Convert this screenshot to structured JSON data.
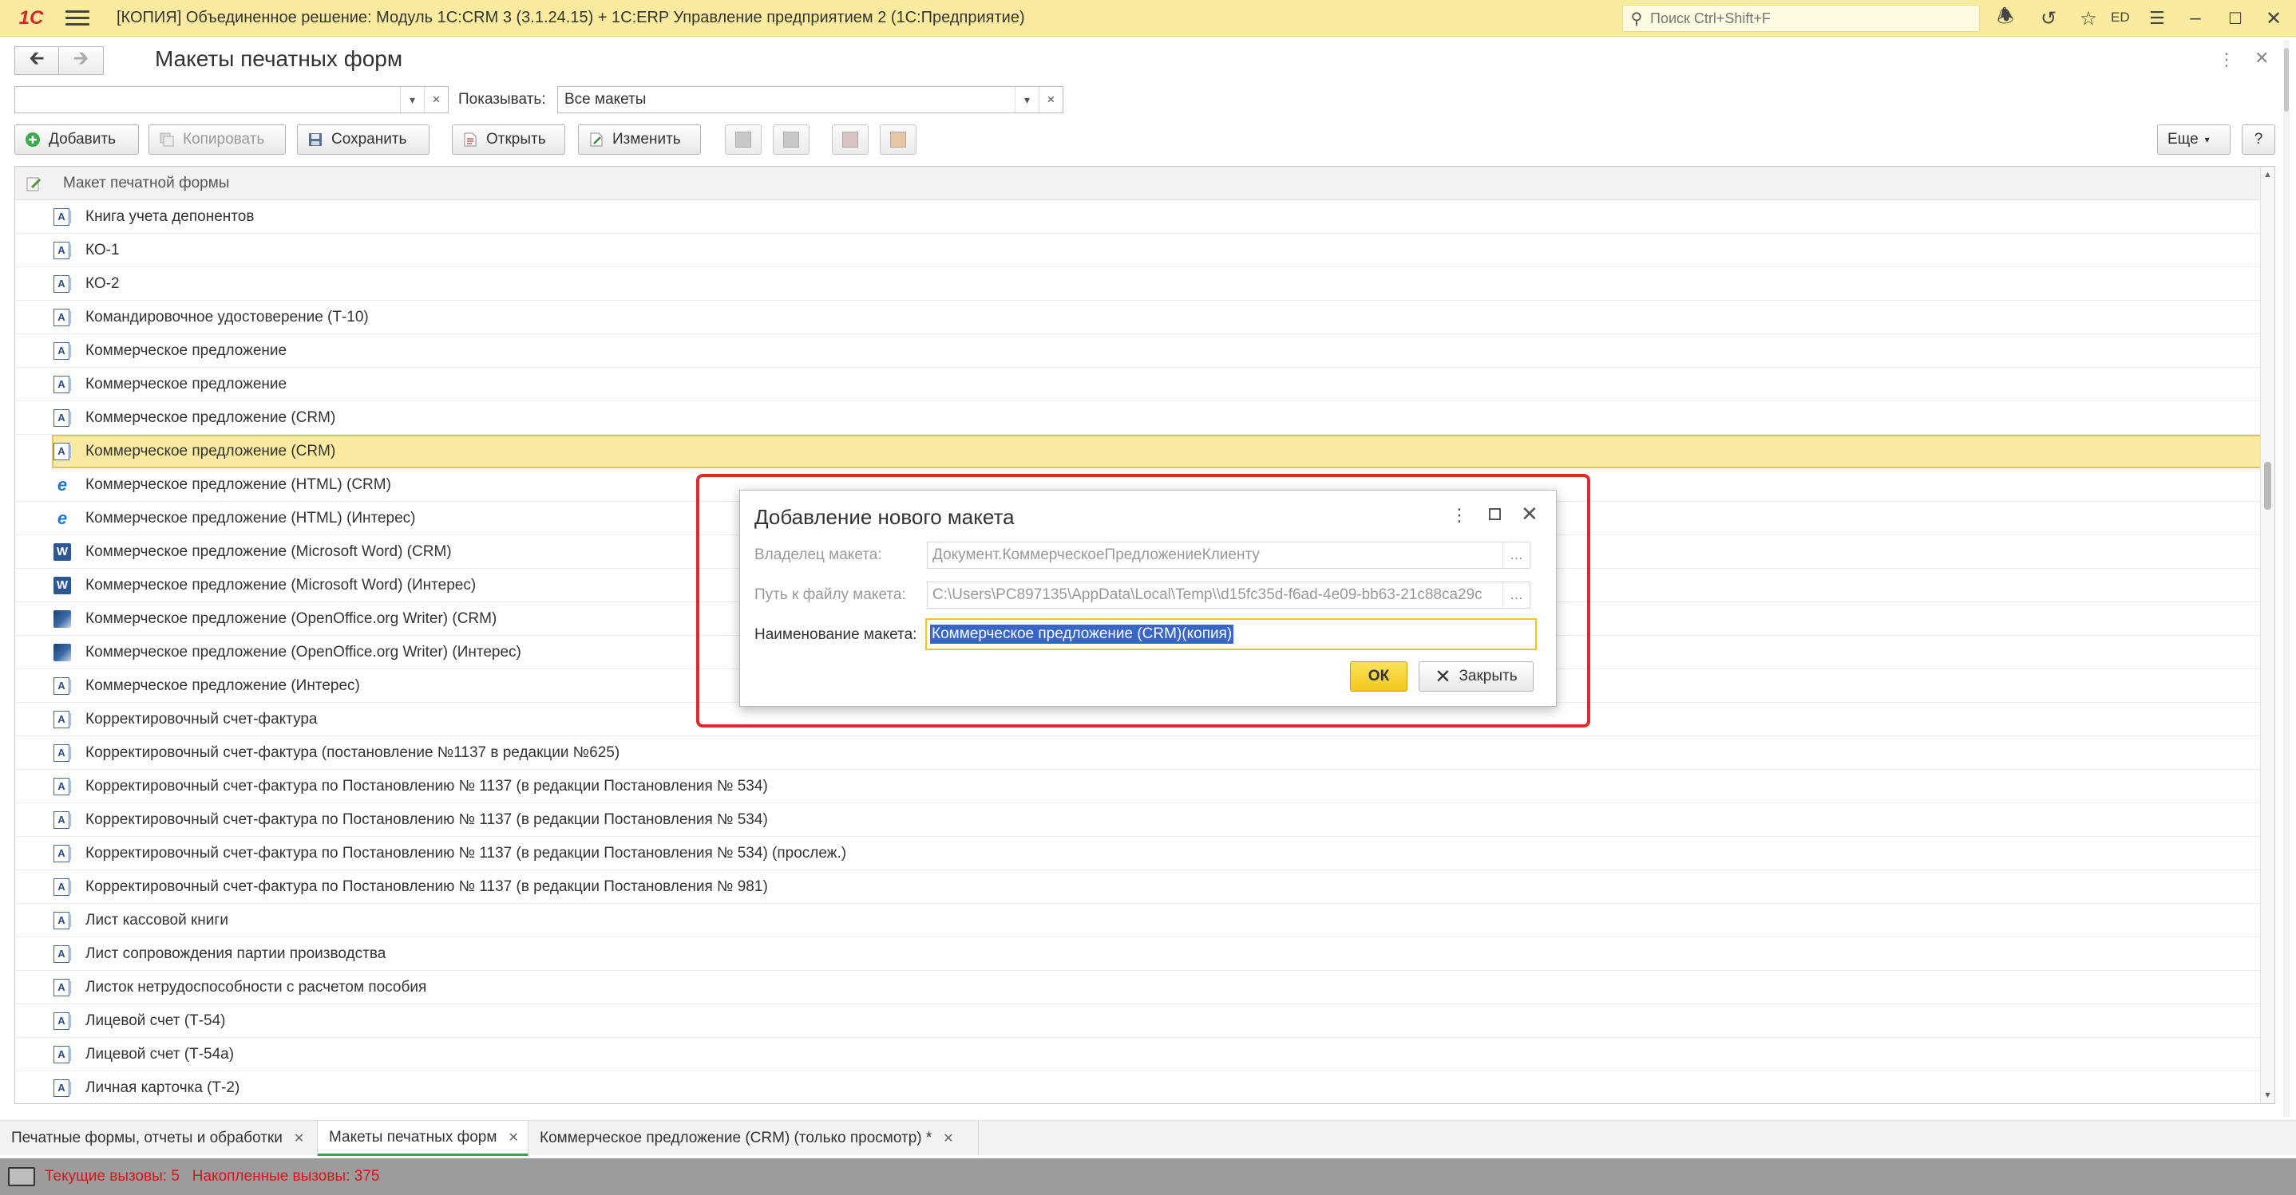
{
  "titlebar": {
    "logo": "1С",
    "title": "[КОПИЯ] Объединенное решение: Модуль 1С:CRM 3 (3.1.24.15) +  1С:ERP Управление предприятием 2   (1С:Предприятие)",
    "search_placeholder": "Поиск Ctrl+Shift+F",
    "user": "ED"
  },
  "header": {
    "title": "Макеты печатных форм"
  },
  "filter": {
    "first_value": "",
    "show_label": "Показывать:",
    "show_value": "Все макеты"
  },
  "toolbar": {
    "add": "Добавить",
    "copy": "Копировать",
    "save": "Сохранить",
    "open": "Открыть",
    "edit": "Изменить",
    "more": "Еще",
    "help": "?"
  },
  "table": {
    "column": "Макет печатной формы",
    "rows": [
      {
        "icon": "template",
        "name": "Книга учета депонентов"
      },
      {
        "icon": "template",
        "name": "КО-1"
      },
      {
        "icon": "template",
        "name": "КО-2"
      },
      {
        "icon": "template",
        "name": "Командировочное удостоверение (Т-10)"
      },
      {
        "icon": "template",
        "name": "Коммерческое предложение"
      },
      {
        "icon": "template",
        "name": "Коммерческое предложение"
      },
      {
        "icon": "template",
        "name": "Коммерческое предложение (CRM)"
      },
      {
        "icon": "template",
        "name": "Коммерческое предложение (CRM)",
        "selected": true
      },
      {
        "icon": "html",
        "name": "Коммерческое предложение (HTML) (CRM)"
      },
      {
        "icon": "html",
        "name": "Коммерческое предложение (HTML) (Интерес)"
      },
      {
        "icon": "word",
        "name": "Коммерческое предложение (Microsoft Word) (CRM)"
      },
      {
        "icon": "word",
        "name": "Коммерческое предложение (Microsoft Word) (Интерес)"
      },
      {
        "icon": "openoffice",
        "name": "Коммерческое предложение (OpenOffice.org Writer) (CRM)"
      },
      {
        "icon": "openoffice",
        "name": "Коммерческое предложение (OpenOffice.org Writer) (Интерес)"
      },
      {
        "icon": "template",
        "name": "Коммерческое предложение (Интерес)"
      },
      {
        "icon": "template",
        "name": "Корректировочный счет-фактура"
      },
      {
        "icon": "template",
        "name": "Корректировочный счет-фактура (постановление №1137 в редакции №625)"
      },
      {
        "icon": "template",
        "name": "Корректировочный счет-фактура по Постановлению № 1137 (в редакции Постановления № 534)"
      },
      {
        "icon": "template",
        "name": "Корректировочный счет-фактура по Постановлению № 1137 (в редакции Постановления № 534)"
      },
      {
        "icon": "template",
        "name": "Корректировочный счет-фактура по Постановлению № 1137 (в редакции Постановления № 534) (прослеж.)"
      },
      {
        "icon": "template",
        "name": "Корректировочный счет-фактура по Постановлению № 1137 (в редакции Постановления № 981)"
      },
      {
        "icon": "template",
        "name": "Лист кассовой книги"
      },
      {
        "icon": "template",
        "name": "Лист сопровождения партии производства"
      },
      {
        "icon": "template",
        "name": "Листок нетрудоспособности с расчетом пособия"
      },
      {
        "icon": "template",
        "name": "Лицевой счет (Т-54)"
      },
      {
        "icon": "template",
        "name": "Лицевой счет (Т-54а)"
      },
      {
        "icon": "template",
        "name": "Личная карточка (Т-2)"
      }
    ]
  },
  "dialog": {
    "title": "Добавление нового макета",
    "owner_label": "Владелец макета:",
    "owner_value": "Документ.КоммерческоеПредложениеКлиенту",
    "path_label": "Путь к файлу макета:",
    "path_value": "C:\\Users\\PC897135\\AppData\\Local\\Temp\\\\d15fc35d-f6ad-4e09-bb63-21c88ca29c",
    "name_label": "Наименование макета:",
    "name_value": "Коммерческое предложение (CRM)(копия)",
    "ok": "ОК",
    "close": "Закрыть"
  },
  "tabs": [
    {
      "label": "Печатные формы, отчеты и обработки",
      "active": false
    },
    {
      "label": "Макеты печатных форм",
      "active": true
    },
    {
      "label": "Коммерческое предложение (CRM) (только просмотр) *",
      "active": false
    }
  ],
  "status": {
    "text": "Текущие вызовы: 5   Накопленные вызовы: 375"
  },
  "colors": {
    "titlebar": "#fbeb9e",
    "selection": "#fbeaa2",
    "ok_button": "#f1c91b",
    "highlight_frame": "#e0282e",
    "status_text": "#d6151b"
  }
}
